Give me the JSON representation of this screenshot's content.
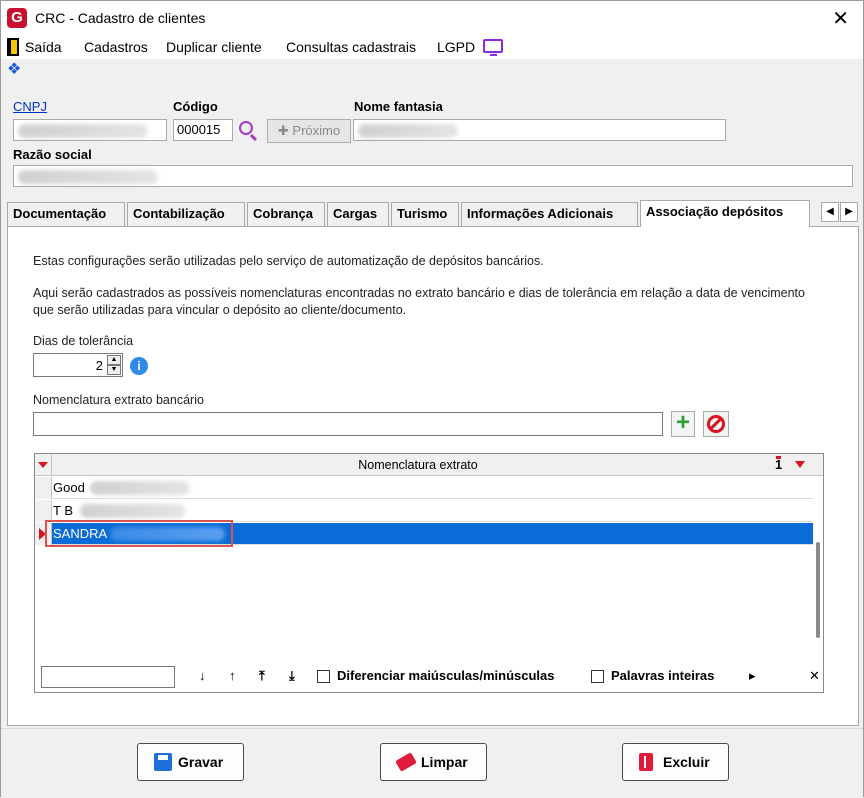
{
  "window": {
    "title": "CRC - Cadastro de clientes",
    "logo_letter": "G",
    "close_glyph": "✕"
  },
  "menu": {
    "items": [
      {
        "label": "Saída"
      },
      {
        "label": "Cadastros"
      },
      {
        "label": "Duplicar cliente"
      },
      {
        "label": "Consultas cadastrais"
      },
      {
        "label": "LGPD"
      }
    ]
  },
  "header": {
    "cnpj_label": "CNPJ",
    "codigo_label": "Código",
    "codigo_value": "000015",
    "proximo_label": "✚ Próximo",
    "nome_fantasia_label": "Nome fantasia",
    "razao_social_label": "Razão social"
  },
  "tabs": [
    {
      "label": "Documentação"
    },
    {
      "label": "Contabilização"
    },
    {
      "label": "Cobrança"
    },
    {
      "label": "Cargas"
    },
    {
      "label": "Turismo"
    },
    {
      "label": "Informações Adicionais"
    },
    {
      "label": "Associação depósitos",
      "active": true
    }
  ],
  "panel": {
    "info1": "Estas configurações serão utilizadas pelo serviço de automatização de depósitos bancários.",
    "info2a": "Aqui serão cadastrados as possíveis nomenclaturas encontradas no extrato bancário e dias de tolerância em relação a data de vencimento",
    "info2b": "que serão utilizadas para vincular o depósito ao cliente/documento.",
    "dias_label": "Dias de tolerância",
    "dias_value": "2",
    "nomenclatura_label": "Nomenclatura extrato bancário"
  },
  "grid": {
    "column_header": "Nomenclatura extrato",
    "rows": [
      {
        "text": "Good"
      },
      {
        "text": "T B"
      },
      {
        "text": "SANDRA",
        "selected": true
      }
    ],
    "find_bar": {
      "diff_case_label": "Diferenciar maiúsculas/minúsculas",
      "whole_words_label": "Palavras inteiras"
    }
  },
  "footer": {
    "gravar_label": "Gravar",
    "limpar_label": "Limpar",
    "excluir_label": "Excluir"
  }
}
